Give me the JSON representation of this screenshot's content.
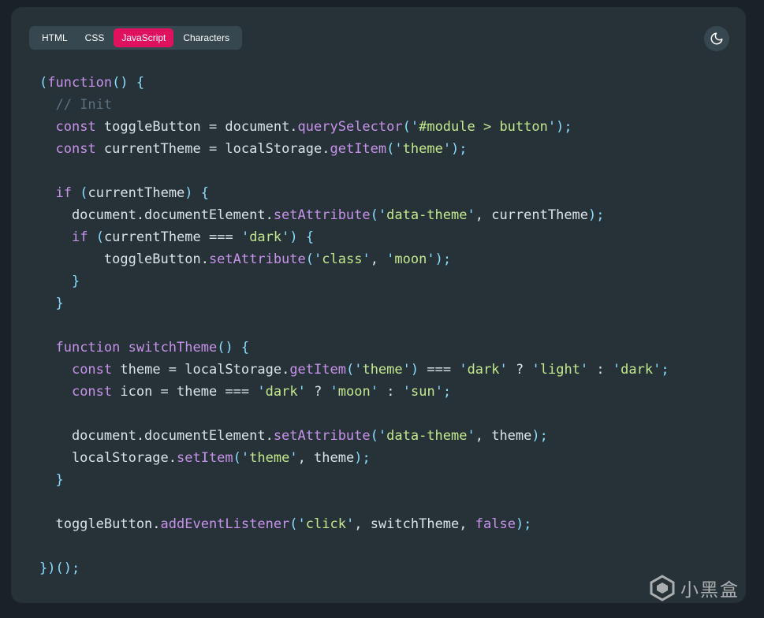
{
  "tabs": [
    {
      "label": "HTML",
      "active": false
    },
    {
      "label": "CSS",
      "active": false
    },
    {
      "label": "JavaScript",
      "active": true
    },
    {
      "label": "Characters",
      "active": false
    }
  ],
  "theme_button": {
    "icon": "moon-icon"
  },
  "code_lines": [
    [
      [
        "p",
        "("
      ],
      [
        "k",
        "function"
      ],
      [
        "p",
        "() {"
      ]
    ],
    [
      [
        "t",
        "  "
      ],
      [
        "c",
        "// Init"
      ]
    ],
    [
      [
        "t",
        "  "
      ],
      [
        "k",
        "const"
      ],
      [
        "t",
        " toggleButton = document."
      ],
      [
        "f",
        "querySelector"
      ],
      [
        "p",
        "('"
      ],
      [
        "s",
        "#module > button"
      ],
      [
        "p",
        "');"
      ]
    ],
    [
      [
        "t",
        "  "
      ],
      [
        "k",
        "const"
      ],
      [
        "t",
        " currentTheme = localStorage."
      ],
      [
        "f",
        "getItem"
      ],
      [
        "p",
        "('"
      ],
      [
        "s",
        "theme"
      ],
      [
        "p",
        "');"
      ]
    ],
    [],
    [
      [
        "t",
        "  "
      ],
      [
        "k",
        "if"
      ],
      [
        "t",
        " "
      ],
      [
        "p",
        "("
      ],
      [
        "t",
        "currentTheme"
      ],
      [
        "p",
        ") {"
      ]
    ],
    [
      [
        "t",
        "    document.documentElement."
      ],
      [
        "f",
        "setAttribute"
      ],
      [
        "p",
        "('"
      ],
      [
        "s",
        "data-theme"
      ],
      [
        "p",
        "'"
      ],
      [
        "t",
        ", currentTheme"
      ],
      [
        "p",
        ");"
      ]
    ],
    [
      [
        "t",
        "    "
      ],
      [
        "k",
        "if"
      ],
      [
        "t",
        " "
      ],
      [
        "p",
        "("
      ],
      [
        "t",
        "currentTheme === "
      ],
      [
        "p",
        "'"
      ],
      [
        "s",
        "dark"
      ],
      [
        "p",
        "') {"
      ]
    ],
    [
      [
        "t",
        "        toggleButton."
      ],
      [
        "f",
        "setAttribute"
      ],
      [
        "p",
        "('"
      ],
      [
        "s",
        "class"
      ],
      [
        "p",
        "'"
      ],
      [
        "t",
        ", "
      ],
      [
        "p",
        "'"
      ],
      [
        "s",
        "moon"
      ],
      [
        "p",
        "');"
      ]
    ],
    [
      [
        "t",
        "    "
      ],
      [
        "p",
        "}"
      ]
    ],
    [
      [
        "t",
        "  "
      ],
      [
        "p",
        "}"
      ]
    ],
    [],
    [
      [
        "t",
        "  "
      ],
      [
        "k",
        "function"
      ],
      [
        "t",
        " "
      ],
      [
        "f",
        "switchTheme"
      ],
      [
        "p",
        "() {"
      ]
    ],
    [
      [
        "t",
        "    "
      ],
      [
        "k",
        "const"
      ],
      [
        "t",
        " theme = localStorage."
      ],
      [
        "f",
        "getItem"
      ],
      [
        "p",
        "('"
      ],
      [
        "s",
        "theme"
      ],
      [
        "p",
        "')"
      ],
      [
        "t",
        " === "
      ],
      [
        "p",
        "'"
      ],
      [
        "s",
        "dark"
      ],
      [
        "p",
        "'"
      ],
      [
        "t",
        " ? "
      ],
      [
        "p",
        "'"
      ],
      [
        "s",
        "light"
      ],
      [
        "p",
        "'"
      ],
      [
        "t",
        " : "
      ],
      [
        "p",
        "'"
      ],
      [
        "s",
        "dark"
      ],
      [
        "p",
        "';"
      ]
    ],
    [
      [
        "t",
        "    "
      ],
      [
        "k",
        "const"
      ],
      [
        "t",
        " icon = theme === "
      ],
      [
        "p",
        "'"
      ],
      [
        "s",
        "dark"
      ],
      [
        "p",
        "'"
      ],
      [
        "t",
        " ? "
      ],
      [
        "p",
        "'"
      ],
      [
        "s",
        "moon"
      ],
      [
        "p",
        "'"
      ],
      [
        "t",
        " : "
      ],
      [
        "p",
        "'"
      ],
      [
        "s",
        "sun"
      ],
      [
        "p",
        "';"
      ]
    ],
    [],
    [
      [
        "t",
        "    document.documentElement."
      ],
      [
        "f",
        "setAttribute"
      ],
      [
        "p",
        "('"
      ],
      [
        "s",
        "data-theme"
      ],
      [
        "p",
        "'"
      ],
      [
        "t",
        ", theme"
      ],
      [
        "p",
        ");"
      ]
    ],
    [
      [
        "t",
        "    localStorage."
      ],
      [
        "f",
        "setItem"
      ],
      [
        "p",
        "('"
      ],
      [
        "s",
        "theme"
      ],
      [
        "p",
        "'"
      ],
      [
        "t",
        ", theme"
      ],
      [
        "p",
        ");"
      ]
    ],
    [
      [
        "t",
        "  "
      ],
      [
        "p",
        "}"
      ]
    ],
    [],
    [
      [
        "t",
        "  toggleButton."
      ],
      [
        "f",
        "addEventListener"
      ],
      [
        "p",
        "('"
      ],
      [
        "s",
        "click"
      ],
      [
        "p",
        "'"
      ],
      [
        "t",
        ", switchTheme, "
      ],
      [
        "k",
        "false"
      ],
      [
        "p",
        ");"
      ]
    ],
    [],
    [
      [
        "p",
        "})();"
      ]
    ]
  ],
  "watermark": {
    "text": "小黑盒"
  },
  "colors": {
    "background": "#263238",
    "tab_active": "#e0115f",
    "keyword": "#c792ea",
    "string": "#c3e88d",
    "punctuation": "#89ddff",
    "comment": "#5c7080",
    "plain": "#dce3e8"
  }
}
